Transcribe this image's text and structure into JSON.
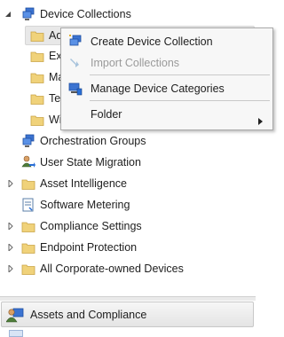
{
  "tree": {
    "device_collections": "Device Collections",
    "children": [
      {
        "label": "Ad"
      },
      {
        "label": "Exe"
      },
      {
        "label": "Ma"
      },
      {
        "label": "Tes"
      },
      {
        "label": "Wi"
      }
    ],
    "orchestration_groups": "Orchestration Groups",
    "user_state_migration": "User State Migration",
    "asset_intelligence": "Asset Intelligence",
    "software_metering": "Software Metering",
    "compliance_settings": "Compliance Settings",
    "endpoint_protection": "Endpoint Protection",
    "all_corporate_owned_devices": "All Corporate-owned Devices"
  },
  "context_menu": {
    "create_device_collection": "Create Device Collection",
    "import_collections": "Import Collections",
    "manage_device_categories": "Manage Device Categories",
    "folder": "Folder"
  },
  "workspace": {
    "assets_and_compliance": "Assets and Compliance"
  },
  "colors": {
    "folder_fill": "#f0d27a",
    "folder_stroke": "#c9a446",
    "accent_blue": "#2a6fd6",
    "menu_bg": "#f7f7f7"
  }
}
